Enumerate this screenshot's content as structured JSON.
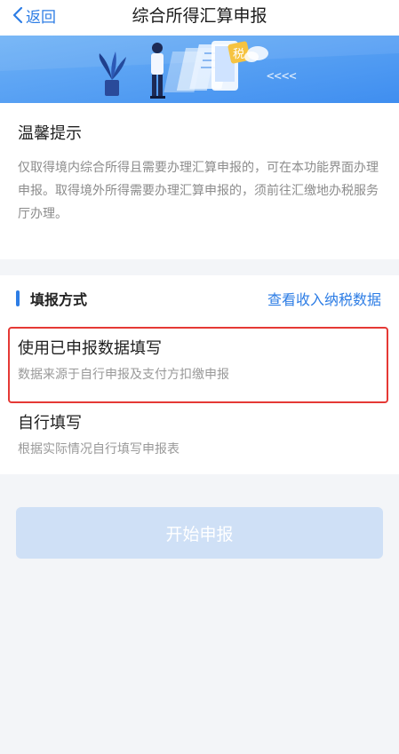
{
  "nav": {
    "back_label": "返回",
    "title": "综合所得汇算申报"
  },
  "banner": {
    "tax_char": "税",
    "arrows": "<<<<"
  },
  "tips": {
    "title": "温馨提示",
    "body": "仅取得境内综合所得且需要办理汇算申报的，可在本功能界面办理申报。取得境外所得需要办理汇算申报的，须前往汇缴地办税服务厅办理。"
  },
  "method": {
    "title": "填报方式",
    "link": "查看收入纳税数据",
    "options": [
      {
        "title": "使用已申报数据填写",
        "desc": "数据来源于自行申报及支付方扣缴申报"
      },
      {
        "title": "自行填写",
        "desc": "根据实际情况自行填写申报表"
      }
    ]
  },
  "start_button": "开始申报",
  "colors": {
    "accent": "#2d7de5",
    "highlight_border": "#e53935",
    "disabled_button": "#cfe0f6"
  }
}
